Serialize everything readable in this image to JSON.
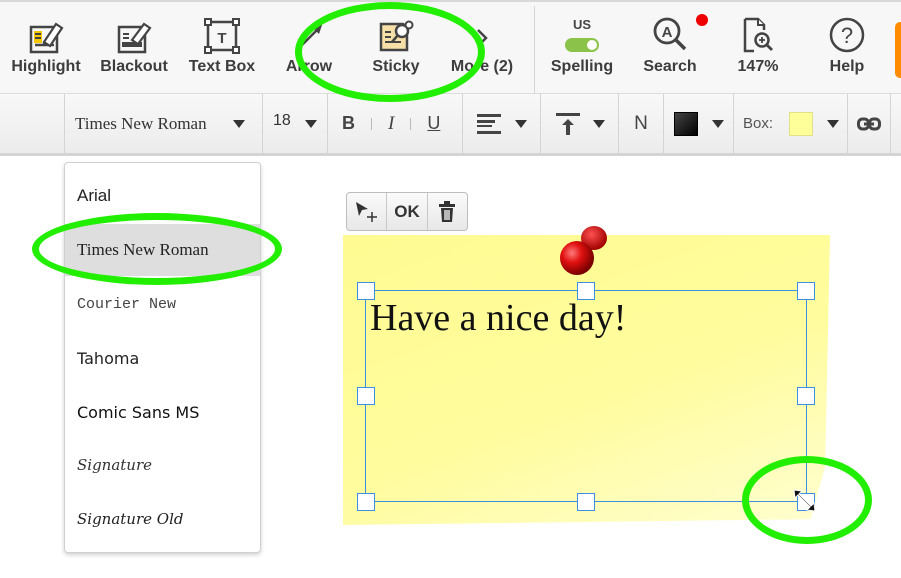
{
  "toolbar": {
    "tools": [
      {
        "id": "highlight",
        "label": "Highlight",
        "icon": "highlight-icon"
      },
      {
        "id": "blackout",
        "label": "Blackout",
        "icon": "blackout-icon"
      },
      {
        "id": "textbox",
        "label": "Text Box",
        "icon": "text-box-icon"
      },
      {
        "id": "arrow",
        "label": "Arrow",
        "icon": "arrow-icon"
      },
      {
        "id": "sticky",
        "label": "Sticky",
        "icon": "sticky-note-icon"
      },
      {
        "id": "more",
        "label": "More (2)",
        "icon": "chevron-right-icon"
      },
      {
        "id": "spelling",
        "label": "Spelling",
        "icon": "toggle-icon",
        "locale": "US",
        "enabled": true
      },
      {
        "id": "search",
        "label": "Search",
        "icon": "search-icon",
        "has_notification": true
      },
      {
        "id": "zoom",
        "label": "147%",
        "icon": "zoom-page-icon"
      },
      {
        "id": "help",
        "label": "Help",
        "icon": "help-icon"
      }
    ]
  },
  "format_bar": {
    "font_family": "Times New Roman",
    "font_size": "18",
    "bold": "B",
    "italic": "I",
    "underline": "U",
    "normal_label": "N",
    "text_color": "#1a1a1a",
    "box_label": "Box:",
    "box_color": "#ffff99"
  },
  "font_dropdown": {
    "selected": "Times New Roman",
    "options": [
      "Arial",
      "Times New Roman",
      "Courier New",
      "Tahoma",
      "Comic Sans MS",
      "Signature",
      "Signature Old"
    ]
  },
  "sticky_toolbar": {
    "ok_label": "OK"
  },
  "sticky_note": {
    "text": "Have a nice day!",
    "color": "#fffb92"
  },
  "colors": {
    "highlight_ring": "#22ee00",
    "selection": "#3d8fe0",
    "accent_orange": "#ff8c00",
    "notification": "#ee0000",
    "toggle_on": "#8bc34a"
  }
}
